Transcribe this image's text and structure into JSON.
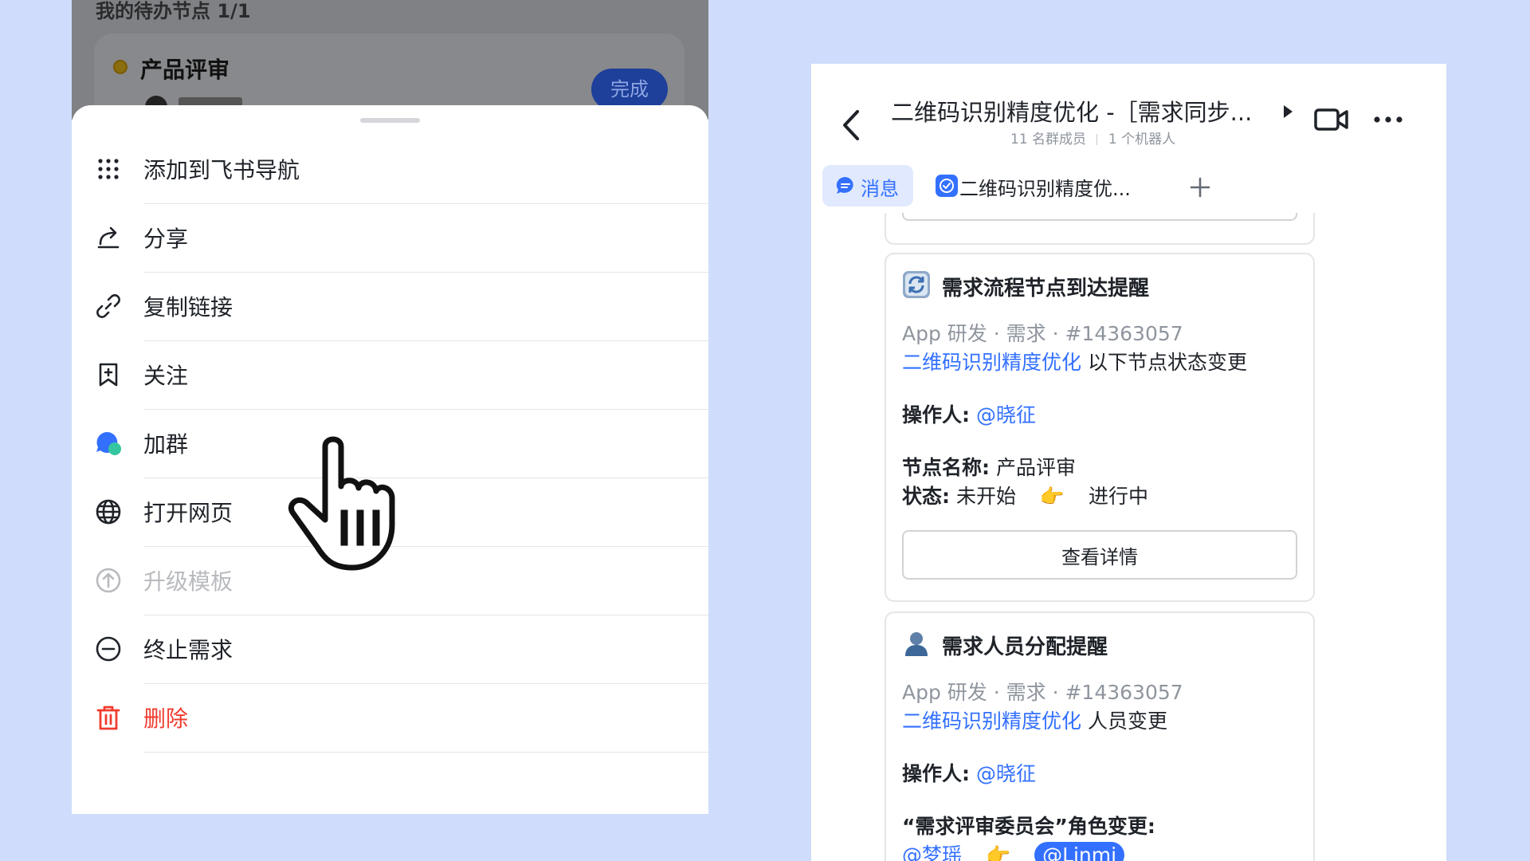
{
  "left_panel": {
    "todo_header": "我的待办节点 1/1",
    "todo_card": {
      "title": "产品评审",
      "done_button": "完成"
    },
    "menu": [
      {
        "label": "添加到飞书导航",
        "icon": "grid-dots-icon",
        "state": "normal"
      },
      {
        "label": "分享",
        "icon": "share-icon",
        "state": "normal"
      },
      {
        "label": "复制链接",
        "icon": "link-icon",
        "state": "normal"
      },
      {
        "label": "关注",
        "icon": "bookmark-add-icon",
        "state": "normal"
      },
      {
        "label": "加群",
        "icon": "group-chat-icon",
        "state": "normal"
      },
      {
        "label": "打开网页",
        "icon": "globe-icon",
        "state": "normal"
      },
      {
        "label": "升级模板",
        "icon": "upgrade-arrow-icon",
        "state": "disabled"
      },
      {
        "label": "终止需求",
        "icon": "minus-circle-icon",
        "state": "normal"
      },
      {
        "label": "删除",
        "icon": "trash-icon",
        "state": "danger"
      }
    ]
  },
  "right_panel": {
    "chat_title": "二维码识别精度优化 -［需求同步...",
    "meta": {
      "members": "11 名群成员",
      "bots": "1 个机器人"
    },
    "tabs": {
      "messages": "消息",
      "doc": "二维码识别精度优..."
    },
    "cards": [
      {
        "icon": "refresh-icon",
        "title": "需求流程节点到达提醒",
        "meta": "App 研发 · 需求 · #14363057",
        "link": "二维码识别精度优化",
        "link_suffix": "以下节点状态变更",
        "operator_label": "操作人:",
        "operator": "@晓征",
        "node_label": "节点名称:",
        "node_value": "产品评审",
        "status_label": "状态:",
        "status_from": "未开始",
        "status_arrow": "👉",
        "status_to": "进行中",
        "button": "查看详情"
      },
      {
        "icon": "person-icon",
        "title": "需求人员分配提醒",
        "meta": "App 研发 · 需求 · #14363057",
        "link": "二维码识别精度优化",
        "link_suffix": "人员变更",
        "operator_label": "操作人:",
        "operator": "@晓征",
        "role_change": "“需求评审委员会”角色变更:",
        "role_from": "@梦瑶",
        "role_arrow": "👉",
        "role_to": "@Linmi"
      }
    ]
  },
  "colors": {
    "background": "#cfdcfb",
    "accent_blue": "#3370ff",
    "danger_red": "#f03c2f",
    "disabled_grey": "#b8babe"
  }
}
